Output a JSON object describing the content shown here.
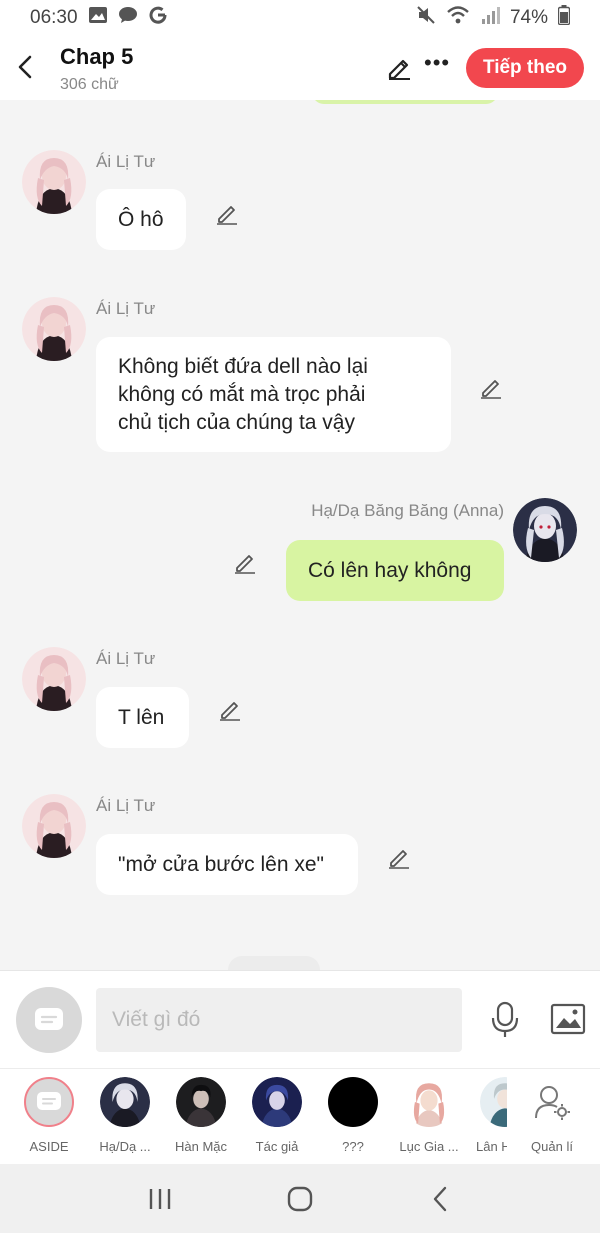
{
  "status": {
    "time": "06:30",
    "battery": "74%",
    "icons_left": [
      "image-icon",
      "chat-bubble-icon",
      "google-icon"
    ],
    "icons_right": [
      "mute-icon",
      "wifi-icon",
      "signal-icon",
      "battery-icon"
    ]
  },
  "header": {
    "title": "Chap 5",
    "subtitle": "306 chữ",
    "next_label": "Tiếp theo"
  },
  "messages": [
    {
      "sender": "Ái Lị Tư",
      "text": "Ô hô",
      "side": "left"
    },
    {
      "sender": "Ái Lị Tư",
      "lines": [
        "Không biết đứa dell nào lại",
        "không có mắt mà trọc phải",
        "chủ tịch của chúng ta vậy"
      ],
      "side": "left"
    },
    {
      "sender": "Hạ/Dạ Băng Băng (Anna)",
      "text": "Có lên hay không",
      "side": "right"
    },
    {
      "sender": "Ái Lị Tư",
      "text": "T lên",
      "side": "left"
    },
    {
      "sender": "Ái Lị Tư",
      "text": "\"mở cửa bước lên xe\"",
      "side": "left"
    }
  ],
  "input": {
    "placeholder": "Viết gì đó"
  },
  "characters": [
    {
      "label": "ASIDE"
    },
    {
      "label": "Hạ/Dạ ..."
    },
    {
      "label": "Hàn Mặc"
    },
    {
      "label": "Tác giả"
    },
    {
      "label": "???"
    },
    {
      "label": "Lục Gia ..."
    },
    {
      "label": "Lân H"
    },
    {
      "label": "Quản lí"
    }
  ],
  "colors": {
    "accent": "#f2474e",
    "my_bubble": "#d8f4a2",
    "background": "#f4f4f4"
  }
}
